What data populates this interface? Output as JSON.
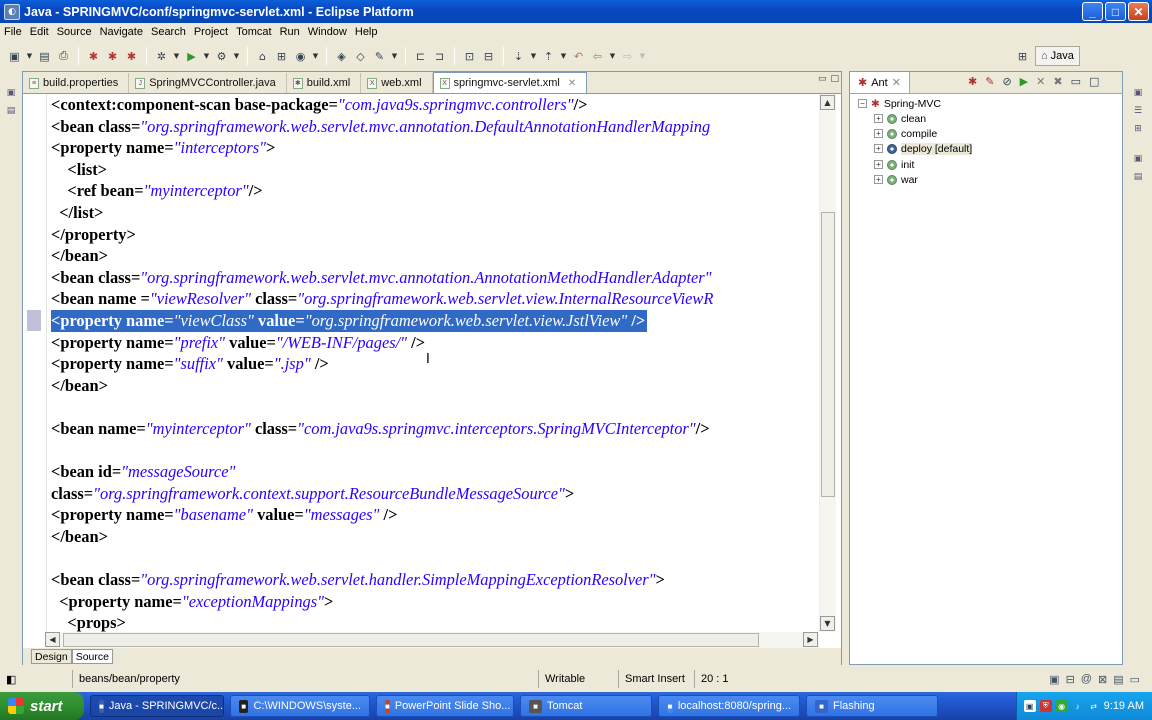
{
  "window": {
    "title": "Java - SPRINGMVC/conf/springmvc-servlet.xml - Eclipse Platform",
    "minimize": "_",
    "maximize": "□",
    "close": "✕"
  },
  "menu": [
    "File",
    "Edit",
    "Source",
    "Navigate",
    "Search",
    "Project",
    "Tomcat",
    "Run",
    "Window",
    "Help"
  ],
  "perspective": {
    "label": "Java"
  },
  "editor": {
    "tabs": [
      {
        "label": "build.properties",
        "active": false
      },
      {
        "label": "SpringMVCController.java",
        "active": false
      },
      {
        "label": "build.xml",
        "active": false
      },
      {
        "label": "web.xml",
        "active": false
      },
      {
        "label": "springmvc-servlet.xml",
        "active": true
      }
    ],
    "lines": [
      [
        {
          "c": "t",
          "s": "<context:component-scan "
        },
        {
          "c": "a",
          "s": "base-package"
        },
        {
          "c": "t",
          "s": "="
        },
        {
          "c": "v",
          "s": "\"com.java9s.springmvc.controllers\""
        },
        {
          "c": "t",
          "s": "/>"
        }
      ],
      [
        {
          "c": "t",
          "s": "<bean "
        },
        {
          "c": "a",
          "s": "class"
        },
        {
          "c": "t",
          "s": "="
        },
        {
          "c": "v",
          "s": "\"org.springframework.web.servlet.mvc.annotation.DefaultAnnotationHandlerMapping"
        }
      ],
      [
        {
          "c": "t",
          "s": "<property "
        },
        {
          "c": "a",
          "s": "name"
        },
        {
          "c": "t",
          "s": "="
        },
        {
          "c": "v",
          "s": "\"interceptors\""
        },
        {
          "c": "t",
          "s": ">"
        }
      ],
      [
        {
          "c": "t",
          "s": "    <list>"
        }
      ],
      [
        {
          "c": "t",
          "s": "    <ref "
        },
        {
          "c": "a",
          "s": "bean"
        },
        {
          "c": "t",
          "s": "="
        },
        {
          "c": "v",
          "s": "\"myinterceptor\""
        },
        {
          "c": "t",
          "s": "/>"
        }
      ],
      [
        {
          "c": "t",
          "s": "  </list>"
        }
      ],
      [
        {
          "c": "t",
          "s": "</property>"
        }
      ],
      [
        {
          "c": "t",
          "s": "</bean>"
        }
      ],
      [
        {
          "c": "t",
          "s": "<bean "
        },
        {
          "c": "a",
          "s": "class"
        },
        {
          "c": "t",
          "s": "="
        },
        {
          "c": "v",
          "s": "\"org.springframework.web.servlet.mvc.annotation.AnnotationMethodHandlerAdapter\""
        }
      ],
      [
        {
          "c": "t",
          "s": "<bean "
        },
        {
          "c": "a",
          "s": "name "
        },
        {
          "c": "t",
          "s": "="
        },
        {
          "c": "v",
          "s": "\"viewResolver\""
        },
        {
          "c": "t",
          "s": " "
        },
        {
          "c": "a",
          "s": "class"
        },
        {
          "c": "t",
          "s": "="
        },
        {
          "c": "v",
          "s": "\"org.springframework.web.servlet.view.InternalResourceViewR"
        }
      ],
      [
        {
          "c": "t",
          "s": "<property "
        },
        {
          "c": "a",
          "s": "name"
        },
        {
          "c": "t",
          "s": "="
        },
        {
          "c": "v",
          "s": "\"viewClass\""
        },
        {
          "c": "t",
          "s": " "
        },
        {
          "c": "a",
          "s": "value"
        },
        {
          "c": "t",
          "s": "="
        },
        {
          "c": "v",
          "s": "\"org.springframework.web.servlet.view.JstlView\""
        },
        {
          "c": "t",
          "s": " />"
        }
      ],
      [
        {
          "c": "t",
          "s": "<property "
        },
        {
          "c": "a",
          "s": "name"
        },
        {
          "c": "t",
          "s": "="
        },
        {
          "c": "v",
          "s": "\"prefix\""
        },
        {
          "c": "t",
          "s": " "
        },
        {
          "c": "a",
          "s": "value"
        },
        {
          "c": "t",
          "s": "="
        },
        {
          "c": "v",
          "s": "\"/WEB-INF/pages/\""
        },
        {
          "c": "t",
          "s": " />"
        }
      ],
      [
        {
          "c": "t",
          "s": "<property "
        },
        {
          "c": "a",
          "s": "name"
        },
        {
          "c": "t",
          "s": "="
        },
        {
          "c": "v",
          "s": "\"suffix\""
        },
        {
          "c": "t",
          "s": " "
        },
        {
          "c": "a",
          "s": "value"
        },
        {
          "c": "t",
          "s": "="
        },
        {
          "c": "v",
          "s": "\".jsp\""
        },
        {
          "c": "t",
          "s": " />"
        }
      ],
      [
        {
          "c": "t",
          "s": "</bean>"
        }
      ],
      [],
      [
        {
          "c": "t",
          "s": "<bean "
        },
        {
          "c": "a",
          "s": "name"
        },
        {
          "c": "t",
          "s": "="
        },
        {
          "c": "v",
          "s": "\"myinterceptor\""
        },
        {
          "c": "t",
          "s": " "
        },
        {
          "c": "a",
          "s": "class"
        },
        {
          "c": "t",
          "s": "="
        },
        {
          "c": "v",
          "s": "\"com.java9s.springmvc.interceptors.SpringMVCInterceptor\""
        },
        {
          "c": "t",
          "s": "/>"
        }
      ],
      [],
      [
        {
          "c": "t",
          "s": "<bean "
        },
        {
          "c": "a",
          "s": "id"
        },
        {
          "c": "t",
          "s": "="
        },
        {
          "c": "v",
          "s": "\"messageSource\""
        }
      ],
      [
        {
          "c": "a",
          "s": "class"
        },
        {
          "c": "t",
          "s": "="
        },
        {
          "c": "v",
          "s": "\"org.springframework.context.support.ResourceBundleMessageSource\""
        },
        {
          "c": "t",
          "s": ">"
        }
      ],
      [
        {
          "c": "t",
          "s": "<property "
        },
        {
          "c": "a",
          "s": "name"
        },
        {
          "c": "t",
          "s": "="
        },
        {
          "c": "v",
          "s": "\"basename\""
        },
        {
          "c": "t",
          "s": " "
        },
        {
          "c": "a",
          "s": "value"
        },
        {
          "c": "t",
          "s": "="
        },
        {
          "c": "v",
          "s": "\"messages\""
        },
        {
          "c": "t",
          "s": " />"
        }
      ],
      [
        {
          "c": "t",
          "s": "</bean>"
        }
      ],
      [],
      [
        {
          "c": "t",
          "s": "<bean "
        },
        {
          "c": "a",
          "s": "class"
        },
        {
          "c": "t",
          "s": "="
        },
        {
          "c": "v",
          "s": "\"org.springframework.web.servlet.handler.SimpleMappingExceptionResolver\""
        },
        {
          "c": "t",
          "s": ">"
        }
      ],
      [
        {
          "c": "t",
          "s": "  <property "
        },
        {
          "c": "a",
          "s": "name"
        },
        {
          "c": "t",
          "s": "="
        },
        {
          "c": "v",
          "s": "\"exceptionMappings\""
        },
        {
          "c": "t",
          "s": ">"
        }
      ],
      [
        {
          "c": "t",
          "s": "    <props>"
        }
      ]
    ],
    "selected_line": 10,
    "bottom_tabs": [
      {
        "label": "Design",
        "active": false
      },
      {
        "label": "Source",
        "active": true
      }
    ]
  },
  "ant": {
    "title": "Ant",
    "project": "Spring-MVC",
    "targets": [
      {
        "label": "clean",
        "default": false
      },
      {
        "label": "compile",
        "default": false
      },
      {
        "label": "deploy [default]",
        "default": true
      },
      {
        "label": "init",
        "default": false
      },
      {
        "label": "war",
        "default": false
      }
    ]
  },
  "status": {
    "path": "beans/bean/property",
    "writable": "Writable",
    "insert": "Smart Insert",
    "position": "20 : 1"
  },
  "taskbar": {
    "start": "start",
    "tasks": [
      {
        "label": "Java - SPRINGMVC/c...",
        "active": true,
        "color": "#3b5fa8"
      },
      {
        "label": "C:\\WINDOWS\\syste...",
        "active": false,
        "color": "#222"
      },
      {
        "label": "PowerPoint Slide Sho...",
        "active": false,
        "color": "#c8461b"
      },
      {
        "label": "Tomcat",
        "active": false,
        "color": "#555"
      },
      {
        "label": "localhost:8080/spring...",
        "active": false,
        "color": "#4285f4"
      },
      {
        "label": "Flashing",
        "active": false,
        "color": "#3366cc"
      }
    ],
    "clock": "9:19 AM"
  }
}
